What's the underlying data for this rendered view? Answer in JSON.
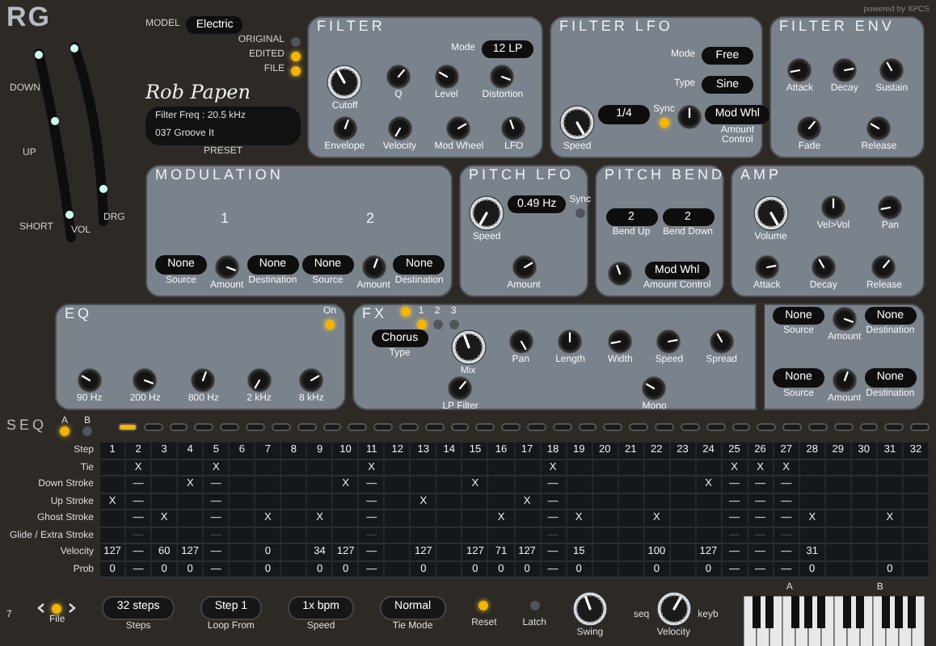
{
  "brand": {
    "logo": "RG",
    "model_label": "MODEL",
    "model_value": "Electric",
    "powered": "powered by XPCS",
    "signature": "Rob Papen",
    "leds": [
      {
        "label": "ORIGINAL",
        "on": false
      },
      {
        "label": "EDITED",
        "on": true
      },
      {
        "label": "FILE",
        "on": true
      }
    ],
    "preset_display": [
      "Filter Freq : 20.5 kHz",
      "037 Groove It"
    ],
    "preset_label": "PRESET"
  },
  "strum": {
    "labels": [
      "DOWN",
      "UP",
      "SHORT",
      "VOL",
      "DRG"
    ]
  },
  "panels": [
    {
      "title": "FILTER",
      "sections": [
        {
          "items": [
            {
              "kind": "pick",
              "label": "Mode",
              "value": "12 LP"
            }
          ]
        },
        {
          "items": [
            {
              "kind": "bigknob",
              "label": "Cutoff"
            },
            {
              "kind": "knob",
              "label": "Q"
            },
            {
              "kind": "knob",
              "label": "Level"
            },
            {
              "kind": "knob",
              "label": "Distortion"
            }
          ]
        },
        {
          "items": [
            {
              "kind": "knob",
              "label": "Envelope"
            },
            {
              "kind": "knob",
              "label": "Velocity"
            },
            {
              "kind": "knob",
              "label": "Mod Wheel"
            },
            {
              "kind": "knob",
              "label": "LFO"
            }
          ]
        }
      ]
    },
    {
      "title": "FILTER LFO",
      "sections": [
        {
          "items": [
            {
              "kind": "pick",
              "label": "Mode",
              "value": "Free"
            }
          ]
        },
        {
          "items": [
            {
              "kind": "pick",
              "label": "Type",
              "value": "Sine"
            }
          ]
        },
        {
          "items": [
            {
              "kind": "bigknob",
              "label": "Speed"
            },
            {
              "kind": "display",
              "value": "1/4"
            },
            {
              "kind": "led",
              "label": "Sync",
              "on": true
            },
            {
              "kind": "knob"
            },
            {
              "kind": "select",
              "value": "Mod Whl",
              "label": "Amount Control"
            }
          ]
        }
      ]
    },
    {
      "title": "FILTER ENV",
      "sections": [
        {
          "items": [
            {
              "kind": "knob",
              "label": "Attack"
            },
            {
              "kind": "knob",
              "label": "Decay"
            },
            {
              "kind": "knob",
              "label": "Sustain"
            }
          ]
        },
        {
          "items": [
            {
              "kind": "knob",
              "label": "Fade"
            },
            {
              "kind": "knob",
              "label": "Release"
            }
          ]
        }
      ]
    },
    {
      "title": "MODULATION",
      "sections": [
        {
          "items": [
            {
              "kind": "heading",
              "text": "1"
            },
            {
              "kind": "heading",
              "text": "2"
            }
          ]
        },
        {
          "items": [
            {
              "kind": "select",
              "value": "None",
              "label": "Source"
            },
            {
              "kind": "knob",
              "label": "Amount"
            },
            {
              "kind": "select",
              "value": "None",
              "label": "Destination"
            },
            {
              "kind": "select",
              "value": "None",
              "label": "Source"
            },
            {
              "kind": "knob",
              "label": "Amount"
            },
            {
              "kind": "select",
              "value": "None",
              "label": "Destination"
            }
          ]
        }
      ]
    },
    {
      "title": "PITCH LFO",
      "sections": [
        {
          "items": [
            {
              "kind": "bigknob",
              "label": "Speed"
            },
            {
              "kind": "display",
              "value": "0.49 Hz"
            },
            {
              "kind": "led",
              "label": "Sync",
              "on": false
            }
          ]
        },
        {
          "items": [
            {
              "kind": "knob",
              "label": "Amount"
            }
          ]
        }
      ]
    },
    {
      "title": "PITCH BEND",
      "sections": [
        {
          "items": [
            {
              "kind": "select",
              "value": "2",
              "label": "Bend Up"
            },
            {
              "kind": "select",
              "value": "2",
              "label": "Bend Down"
            }
          ]
        },
        {
          "items": [
            {
              "kind": "knob"
            },
            {
              "kind": "select",
              "value": "Mod Whl",
              "label": "Amount Control"
            }
          ]
        }
      ]
    },
    {
      "title": "AMP",
      "sections": [
        {
          "items": [
            {
              "kind": "bigknob",
              "label": "Volume"
            },
            {
              "kind": "knob",
              "label": "Vel>Vol"
            },
            {
              "kind": "knob",
              "label": "Pan"
            }
          ]
        },
        {
          "items": [
            {
              "kind": "knob",
              "label": "Attack"
            },
            {
              "kind": "knob",
              "label": "Decay"
            },
            {
              "kind": "knob",
              "label": "Release"
            }
          ]
        }
      ]
    },
    {
      "title": "EQ",
      "sections": [
        {
          "items": [
            {
              "kind": "led",
              "label": "On",
              "on": true
            }
          ]
        },
        {
          "items": [
            {
              "kind": "knob",
              "label": "90 Hz"
            },
            {
              "kind": "knob",
              "label": "200 Hz"
            },
            {
              "kind": "knob",
              "label": "800 Hz"
            },
            {
              "kind": "knob",
              "label": "2 kHz"
            },
            {
              "kind": "knob",
              "label": "8 kHz"
            }
          ]
        }
      ]
    },
    {
      "title": "FX",
      "sections": [
        {
          "items": [
            {
              "kind": "led",
              "on": true
            },
            {
              "kind": "led",
              "label": "1",
              "on": true
            },
            {
              "kind": "led",
              "label": "2",
              "on": false
            },
            {
              "kind": "led",
              "label": "3",
              "on": false
            }
          ]
        },
        {
          "items": [
            {
              "kind": "select",
              "value": "Chorus",
              "label": "Type"
            },
            {
              "kind": "bigknob",
              "label": "Mix"
            },
            {
              "kind": "knob",
              "label": "Pan"
            },
            {
              "kind": "knob",
              "label": "Length"
            },
            {
              "kind": "knob",
              "label": "Width"
            },
            {
              "kind": "knob",
              "label": "Speed"
            },
            {
              "kind": "knob",
              "label": "Spread"
            }
          ]
        },
        {
          "items": [
            {
              "kind": "knob",
              "label": "LP Filter"
            },
            {
              "kind": "knob",
              "label": "Mono"
            }
          ]
        }
      ]
    },
    {
      "sections": [
        {
          "items": [
            {
              "kind": "select",
              "value": "None",
              "label": "Source"
            },
            {
              "kind": "knob",
              "label": "Amount"
            },
            {
              "kind": "select",
              "value": "None",
              "label": "Destination"
            }
          ]
        },
        {
          "items": [
            {
              "kind": "select",
              "value": "None",
              "label": "Source"
            },
            {
              "kind": "knob",
              "label": "Amount"
            },
            {
              "kind": "select",
              "value": "None",
              "label": "Destination"
            }
          ]
        }
      ]
    }
  ],
  "seq": {
    "title": "SEQ",
    "banks": [
      {
        "label": "A",
        "on": true
      },
      {
        "label": "B",
        "on": false
      }
    ],
    "step_leds": [
      {
        "on": true
      },
      {
        "on": false
      },
      {
        "on": false
      },
      {
        "on": false
      },
      {
        "on": false
      },
      {
        "on": false
      },
      {
        "on": false
      },
      {
        "on": false
      },
      {
        "on": false
      },
      {
        "on": false
      },
      {
        "on": false
      },
      {
        "on": false
      },
      {
        "on": false
      },
      {
        "on": false
      },
      {
        "on": false
      },
      {
        "on": false
      },
      {
        "on": false
      },
      {
        "on": false
      },
      {
        "on": false
      },
      {
        "on": false
      },
      {
        "on": false
      },
      {
        "on": false
      },
      {
        "on": false
      },
      {
        "on": false
      },
      {
        "on": false
      },
      {
        "on": false
      },
      {
        "on": false
      },
      {
        "on": false
      },
      {
        "on": false
      },
      {
        "on": false
      },
      {
        "on": false
      },
      {
        "on": false
      }
    ],
    "rows": [
      {
        "label": "Step",
        "dim": false,
        "cells": [
          "1",
          "2",
          "3",
          "4",
          "5",
          "6",
          "7",
          "8",
          "9",
          "10",
          "11",
          "12",
          "13",
          "14",
          "15",
          "16",
          "17",
          "18",
          "19",
          "20",
          "21",
          "22",
          "23",
          "24",
          "25",
          "26",
          "27",
          "28",
          "29",
          "30",
          "31",
          "32"
        ]
      },
      {
        "label": "Tie",
        "dim": false,
        "cells": [
          null,
          "X",
          null,
          null,
          "X",
          null,
          null,
          null,
          null,
          null,
          "X",
          null,
          null,
          null,
          null,
          null,
          null,
          "X",
          null,
          null,
          null,
          null,
          null,
          null,
          "X",
          "X",
          "X",
          null,
          null,
          null,
          null,
          null
        ]
      },
      {
        "label": "Down Stroke",
        "dim": false,
        "cells": [
          null,
          "—",
          null,
          "X",
          "—",
          null,
          null,
          null,
          null,
          "X",
          "—",
          null,
          null,
          null,
          "X",
          null,
          null,
          "—",
          null,
          null,
          null,
          null,
          null,
          "X",
          "—",
          "—",
          "—",
          null,
          null,
          null,
          null,
          null
        ]
      },
      {
        "label": "Up Stroke",
        "dim": false,
        "cells": [
          "X",
          "—",
          null,
          null,
          "—",
          null,
          null,
          null,
          null,
          null,
          "—",
          null,
          "X",
          null,
          null,
          null,
          "X",
          "—",
          null,
          null,
          null,
          null,
          null,
          null,
          "—",
          "—",
          "—",
          null,
          null,
          null,
          null,
          null
        ]
      },
      {
        "label": "Ghost Stroke",
        "dim": false,
        "cells": [
          null,
          "—",
          "X",
          null,
          "—",
          null,
          "X",
          null,
          "X",
          null,
          "—",
          null,
          null,
          null,
          null,
          "X",
          null,
          "—",
          "X",
          null,
          null,
          "X",
          null,
          null,
          "—",
          "—",
          "—",
          "X",
          null,
          null,
          "X",
          null
        ]
      },
      {
        "label": "Glide / Extra Stroke",
        "dim": true,
        "cells": [
          null,
          "—",
          null,
          null,
          "—",
          null,
          null,
          null,
          null,
          null,
          "—",
          null,
          null,
          null,
          null,
          null,
          null,
          "—",
          null,
          null,
          null,
          null,
          null,
          null,
          "—",
          "—",
          "—",
          null,
          null,
          null,
          null,
          null
        ]
      },
      {
        "label": "Velocity",
        "dim": false,
        "cells": [
          "127",
          "—",
          "60",
          "127",
          "—",
          null,
          "0",
          null,
          "34",
          "127",
          "—",
          null,
          "127",
          null,
          "127",
          "71",
          "127",
          "—",
          "15",
          null,
          null,
          "100",
          null,
          "127",
          "—",
          "—",
          "—",
          "31",
          null,
          null,
          null,
          null
        ]
      },
      {
        "label": "Prob",
        "dim": false,
        "cells": [
          "0",
          "—",
          "0",
          "0",
          "—",
          null,
          "0",
          null,
          "0",
          "0",
          "—",
          null,
          "0",
          null,
          "0",
          "0",
          "0",
          "—",
          "0",
          null,
          null,
          "0",
          null,
          "0",
          "—",
          "—",
          "—",
          "0",
          null,
          null,
          "0",
          null
        ]
      }
    ]
  },
  "bottom": {
    "file": {
      "label": "File",
      "on": true
    },
    "selects": [
      {
        "value": "32 steps",
        "label": "Steps"
      },
      {
        "value": "Step 1",
        "label": "Loop From"
      },
      {
        "value": "1x bpm",
        "label": "Speed"
      },
      {
        "value": "Normal",
        "label": "Tie Mode"
      }
    ],
    "leds": [
      {
        "label": "Reset",
        "on": true
      },
      {
        "label": "Latch",
        "on": false
      }
    ],
    "swing": {
      "label": "Swing"
    },
    "velocity": {
      "label": "Velocity",
      "left": "seq",
      "right": "keyb"
    },
    "keyboard": {
      "markers": [
        "A",
        "B"
      ]
    },
    "corner": "7"
  }
}
